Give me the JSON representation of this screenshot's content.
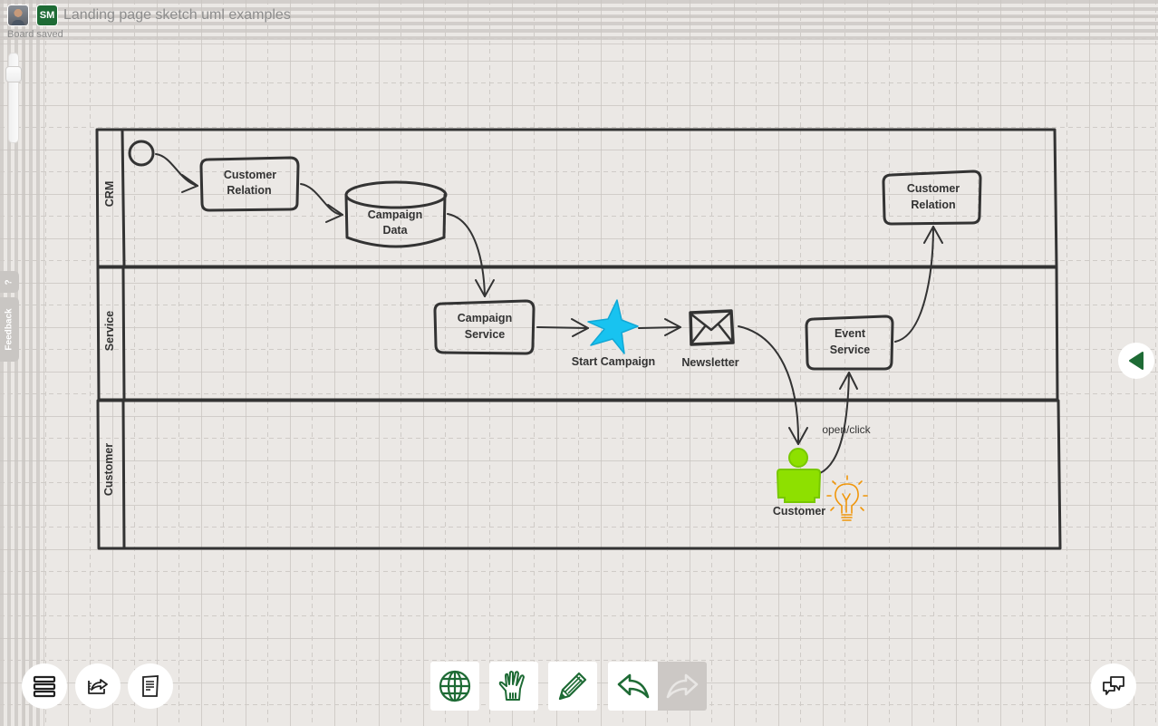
{
  "header": {
    "avatar": "user-avatar",
    "initials": "SM",
    "board_title": "Landing page sketch uml examples",
    "status": "Board saved"
  },
  "zoom_slider": {
    "level_fraction": 0.15
  },
  "side_tabs": {
    "help": "?",
    "feedback": "Feedback"
  },
  "diagram": {
    "swimlanes": [
      {
        "label": "CRM"
      },
      {
        "label": "Service"
      },
      {
        "label": "Customer"
      }
    ],
    "nodes": {
      "start": {
        "type": "start-circle"
      },
      "customer_relation_1": {
        "line1": "Customer",
        "line2": "Relation"
      },
      "campaign_data": {
        "line1": "Campaign",
        "line2": "Data"
      },
      "campaign_service": {
        "line1": "Campaign",
        "line2": "Service"
      },
      "start_campaign": {
        "label": "Start Campaign",
        "icon": "star-icon",
        "color": "#18c3f0"
      },
      "newsletter": {
        "label": "Newsletter",
        "icon": "envelope-icon"
      },
      "event_service": {
        "line1": "Event",
        "line2": "Service"
      },
      "customer_relation_2": {
        "line1": "Customer",
        "line2": "Relation"
      },
      "customer_actor": {
        "label": "Customer",
        "icon": "person-icon",
        "color": "#8ee000"
      },
      "idea": {
        "icon": "lightbulb-icon",
        "color": "#f0960a"
      }
    },
    "edges": [
      {
        "from": "start",
        "to": "customer_relation_1",
        "label": ""
      },
      {
        "from": "customer_relation_1",
        "to": "campaign_data",
        "label": ""
      },
      {
        "from": "campaign_data",
        "to": "campaign_service",
        "label": ""
      },
      {
        "from": "campaign_service",
        "to": "start_campaign",
        "label": ""
      },
      {
        "from": "start_campaign",
        "to": "newsletter",
        "label": ""
      },
      {
        "from": "newsletter",
        "to": "customer_actor",
        "label": ""
      },
      {
        "from": "customer_actor",
        "to": "event_service",
        "label": "open/click"
      },
      {
        "from": "event_service",
        "to": "customer_relation_2",
        "label": ""
      }
    ]
  },
  "bottom_left_buttons": [
    {
      "name": "layers-menu",
      "icon": "stack-icon"
    },
    {
      "name": "export",
      "icon": "export-icon"
    },
    {
      "name": "notes",
      "icon": "document-icon"
    }
  ],
  "toolbar": {
    "accent": "#1e6b35",
    "tools": [
      {
        "name": "globe",
        "icon": "globe-icon"
      },
      {
        "name": "hand",
        "icon": "hand-icon"
      },
      {
        "name": "pencil",
        "icon": "pencil-icon"
      },
      {
        "name": "undo",
        "icon": "undo-icon"
      },
      {
        "name": "redo",
        "icon": "redo-icon",
        "disabled": true
      }
    ]
  },
  "right_panel_toggle": {
    "icon": "triangle-left-icon"
  },
  "chat_button": {
    "icon": "chat-bubbles-icon"
  }
}
